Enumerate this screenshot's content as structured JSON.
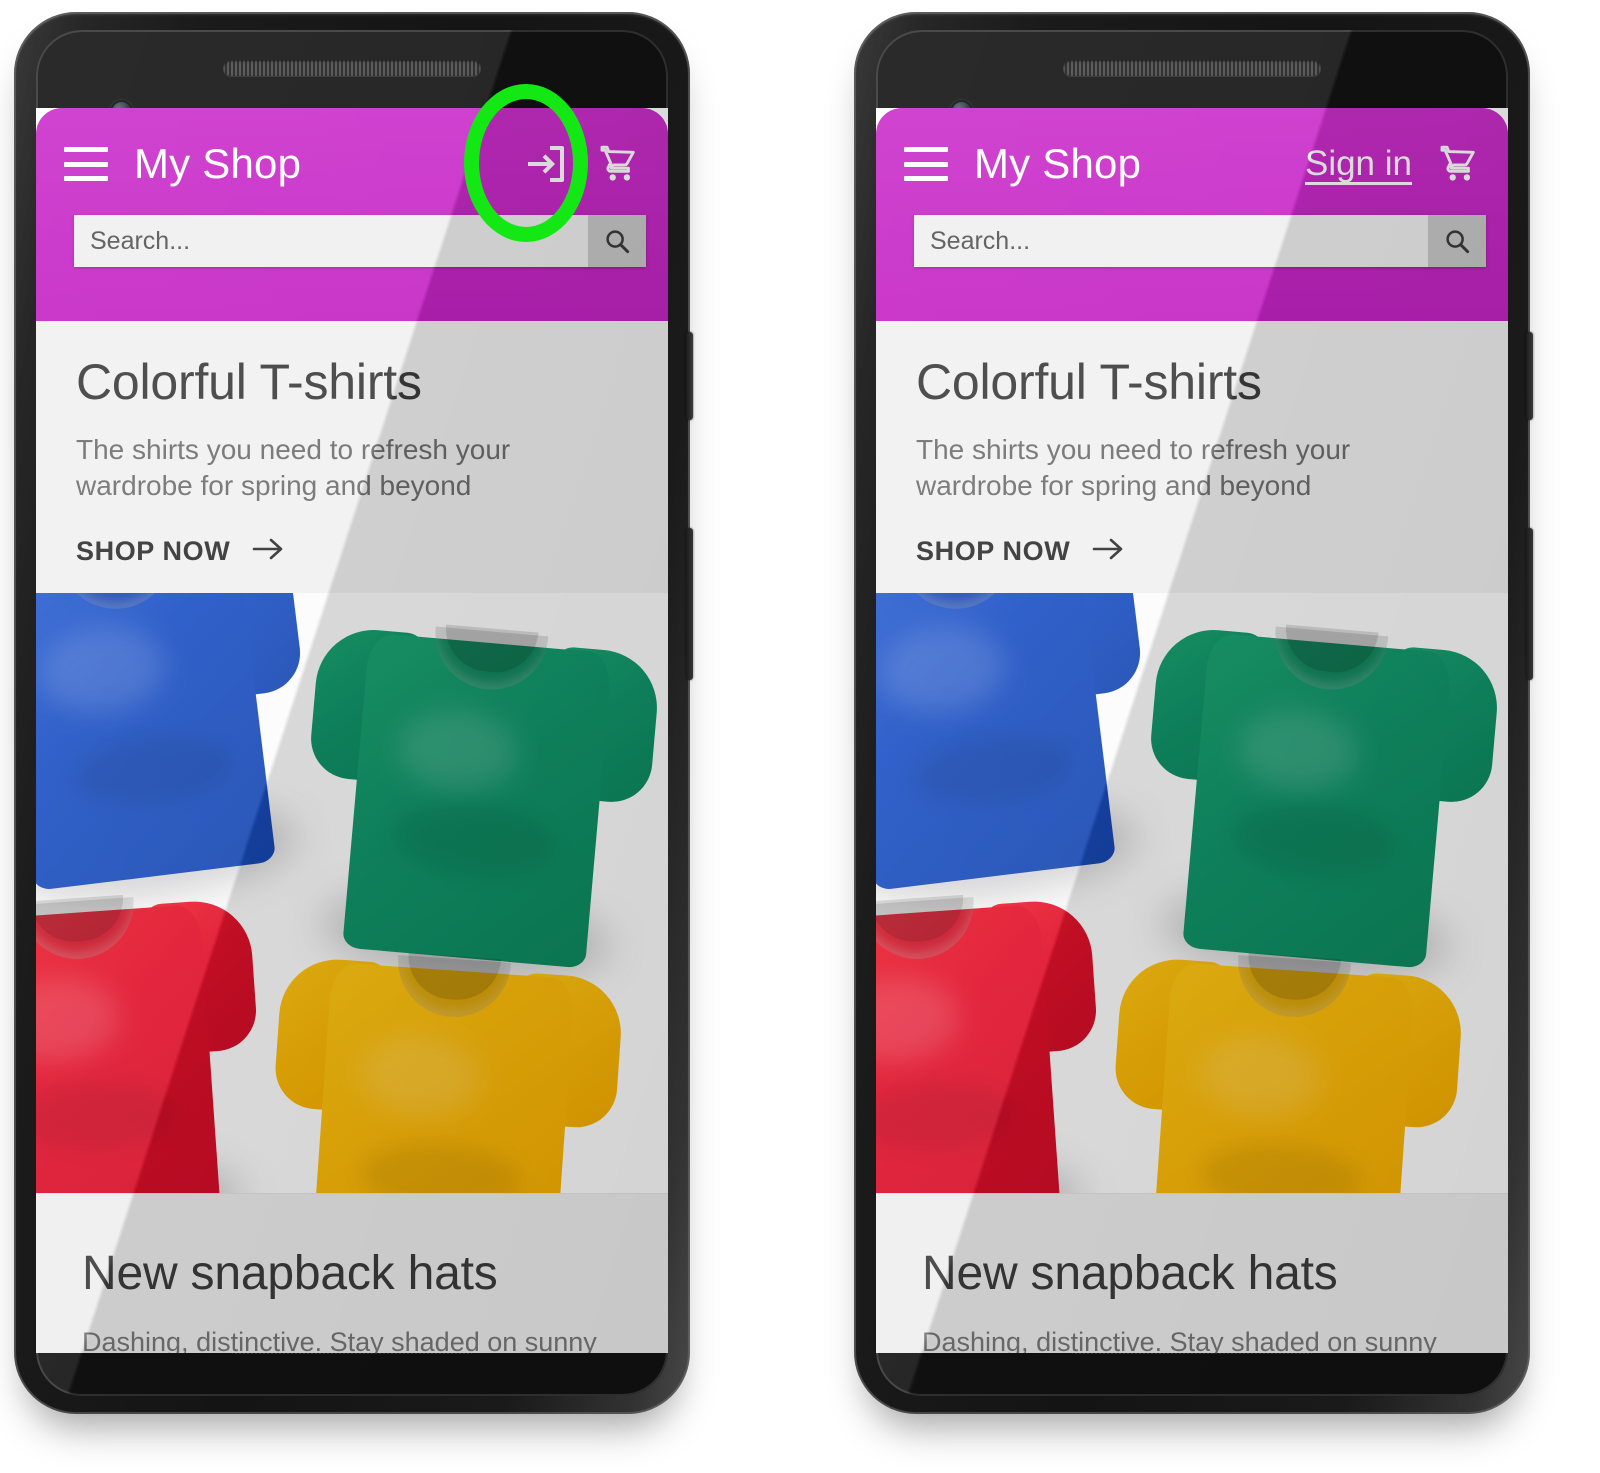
{
  "figure": {
    "type": "before-after-comparison",
    "panels": 2,
    "annotation_color": "#14e814"
  },
  "app": {
    "brand": "My Shop",
    "header_color": "#c828c8",
    "menu_icon": "hamburger-menu-icon",
    "cart_icon": "shopping-cart-icon"
  },
  "search": {
    "placeholder": "Search...",
    "value": "",
    "button_icon": "magnifier-search-icon"
  },
  "hero": {
    "title": "Colorful T-shirts",
    "subtitle": "The shirts you need to refresh your wardrobe for spring and beyond",
    "cta_label": "SHOP NOW",
    "cta_icon": "arrow-right-icon",
    "image_alt": "Four folded t-shirts: blue, green, red, yellow",
    "shirt_colors": [
      "#1b50c4",
      "#10956a",
      "#e0102a",
      "#fcb908"
    ]
  },
  "second_card": {
    "title": "New snapback hats",
    "subtitle": "Dashing, distinctive. Stay shaded on sunny"
  },
  "panels": [
    {
      "id": "before",
      "auth_control": "login-icon",
      "auth_label": "",
      "auth_icon": "exit-to-app-login-icon",
      "annotation": "oval-highlight"
    },
    {
      "id": "after",
      "auth_control": "text-link",
      "auth_label": "Sign in",
      "auth_icon": "",
      "annotation": "circle-highlight"
    }
  ],
  "device": {
    "kind": "android-smartphone",
    "front_camera": "camera-icon",
    "earpiece": "speaker-grill",
    "bottom_speaker": "speaker-grill",
    "side_buttons": [
      "power-button",
      "volume-rocker"
    ]
  }
}
